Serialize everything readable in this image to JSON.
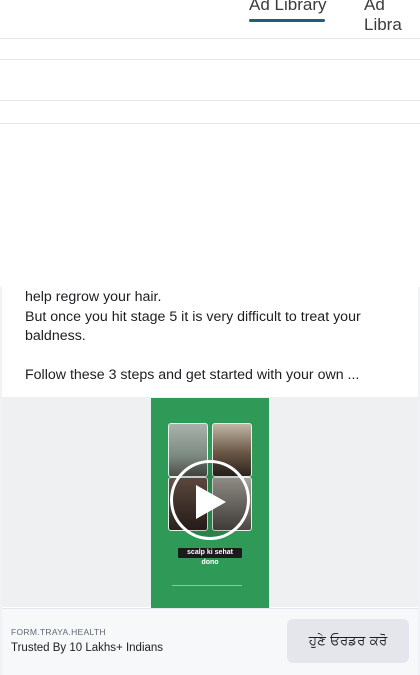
{
  "tabs": [
    {
      "label": "Ad Library"
    },
    {
      "label": "Ad Libra"
    }
  ],
  "ad": {
    "body_lines": [
      "help regrow your hair.",
      "But once you hit stage 5 it is very difficult to treat your baldness.",
      "",
      "Follow these 3 steps and get started with your own ..."
    ],
    "video_caption": "scalp ki sehat dono",
    "domain": "FORM.TRAYA.HEALTH",
    "subtitle": "Trusted By 10 Lakhs+ Indians",
    "cta_label": "ਹੁਣੇ ਓਰਡਰ ਕਰੋ"
  },
  "colors": {
    "video_bg": "#2f9a58",
    "tab_underline": "#1b5f7a",
    "cta_bg": "#e4e6eb"
  }
}
